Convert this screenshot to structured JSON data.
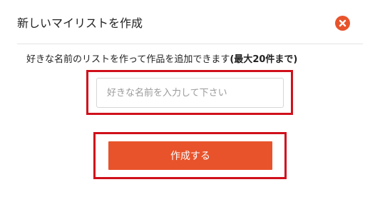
{
  "dialog": {
    "title": "新しいマイリストを作成",
    "close_icon": "close-icon",
    "description_main": "好きな名前のリストを作って作品を追加できます",
    "description_note_open": "(最大",
    "description_note_count": "20",
    "description_note_close": "件まで)",
    "name_input": {
      "placeholder": "好きな名前を入力して下さい",
      "value": ""
    },
    "create_button_label": "作成する"
  },
  "colors": {
    "accent": "#e8532b",
    "highlight_border": "#d0101b"
  }
}
